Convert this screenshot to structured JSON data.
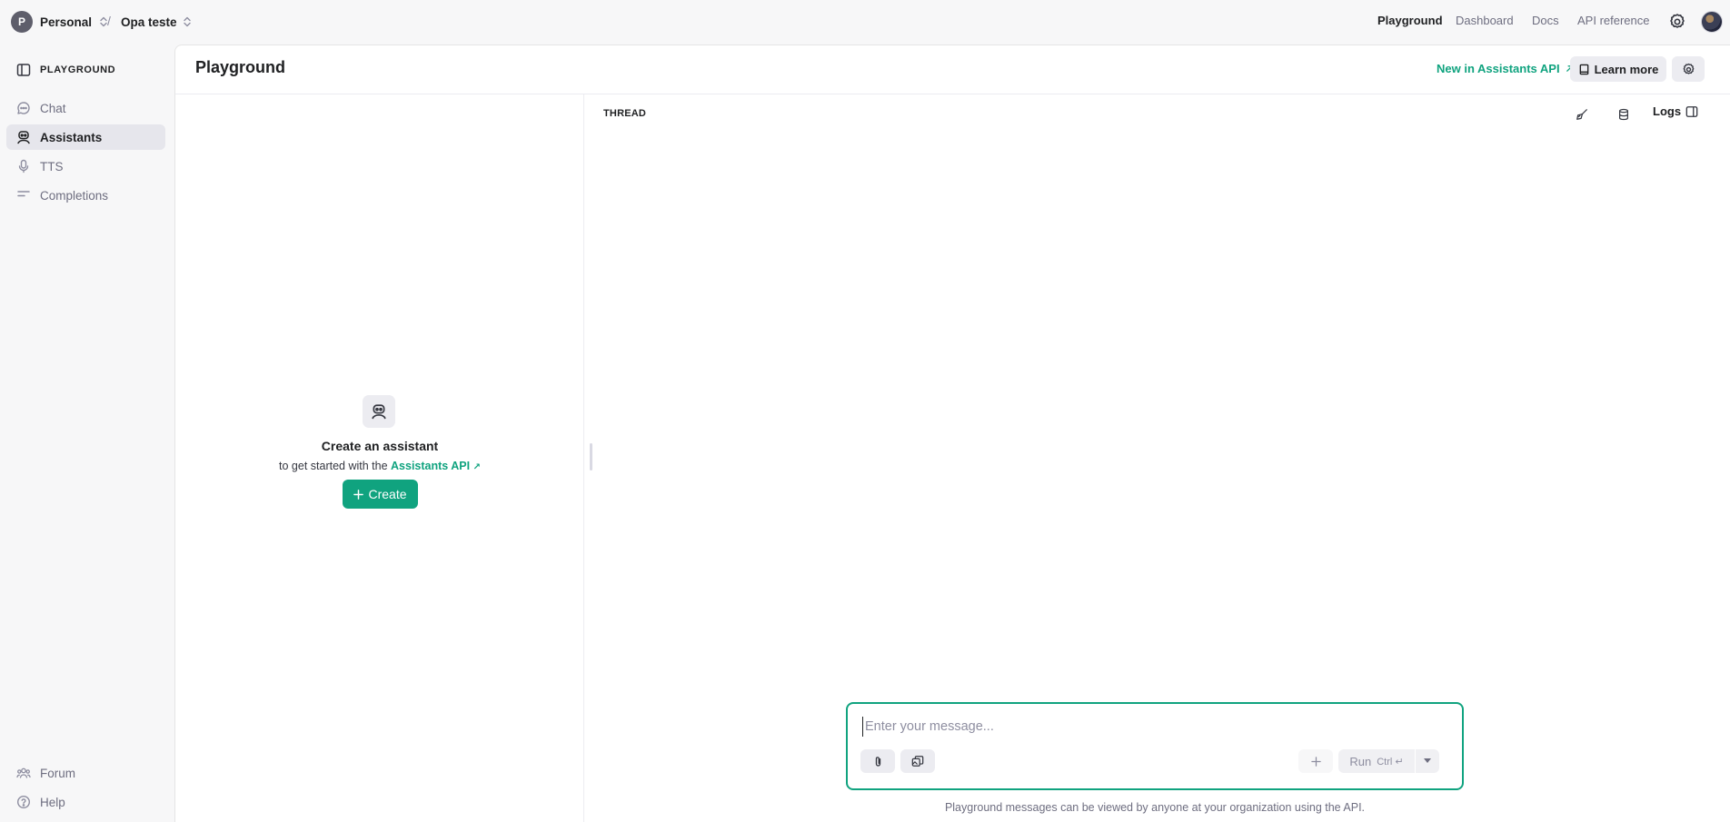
{
  "org": {
    "avatar_letter": "P",
    "name": "Personal"
  },
  "breadcrumb_separator": "/",
  "project": {
    "name": "Opa teste"
  },
  "topnav": [
    {
      "label": "Playground"
    },
    {
      "label": "Dashboard"
    },
    {
      "label": "Docs"
    },
    {
      "label": "API reference"
    }
  ],
  "sidebar": {
    "header": "PLAYGROUND",
    "items": [
      {
        "label": "Chat",
        "icon": "chat-bubble-icon"
      },
      {
        "label": "Assistants",
        "icon": "assistant-icon",
        "active": true
      },
      {
        "label": "TTS",
        "icon": "microphone-icon"
      },
      {
        "label": "Completions",
        "icon": "completions-lines-icon"
      }
    ],
    "bottom_items": [
      {
        "label": "Forum",
        "icon": "people-icon"
      },
      {
        "label": "Help",
        "icon": "help-circle-icon"
      }
    ]
  },
  "main": {
    "title": "Playground",
    "new_in_link": "New in Assistants API",
    "learn_more": "Learn more"
  },
  "empty_state": {
    "title": "Create an assistant",
    "subtitle_prefix": "to get started with the",
    "link": "Assistants API",
    "create_button": "Create"
  },
  "thread": {
    "label": "THREAD",
    "logs": "Logs"
  },
  "composer": {
    "placeholder": "Enter your message...",
    "run_label": "Run",
    "run_shortcut": "Ctrl ↵"
  },
  "footer_note": "Playground messages can be viewed by anyone at your organization using the API.",
  "colors": {
    "accent": "#10a37f",
    "sidebar_bg": "#f7f7f8",
    "active_item_bg": "#e6e6ec"
  }
}
